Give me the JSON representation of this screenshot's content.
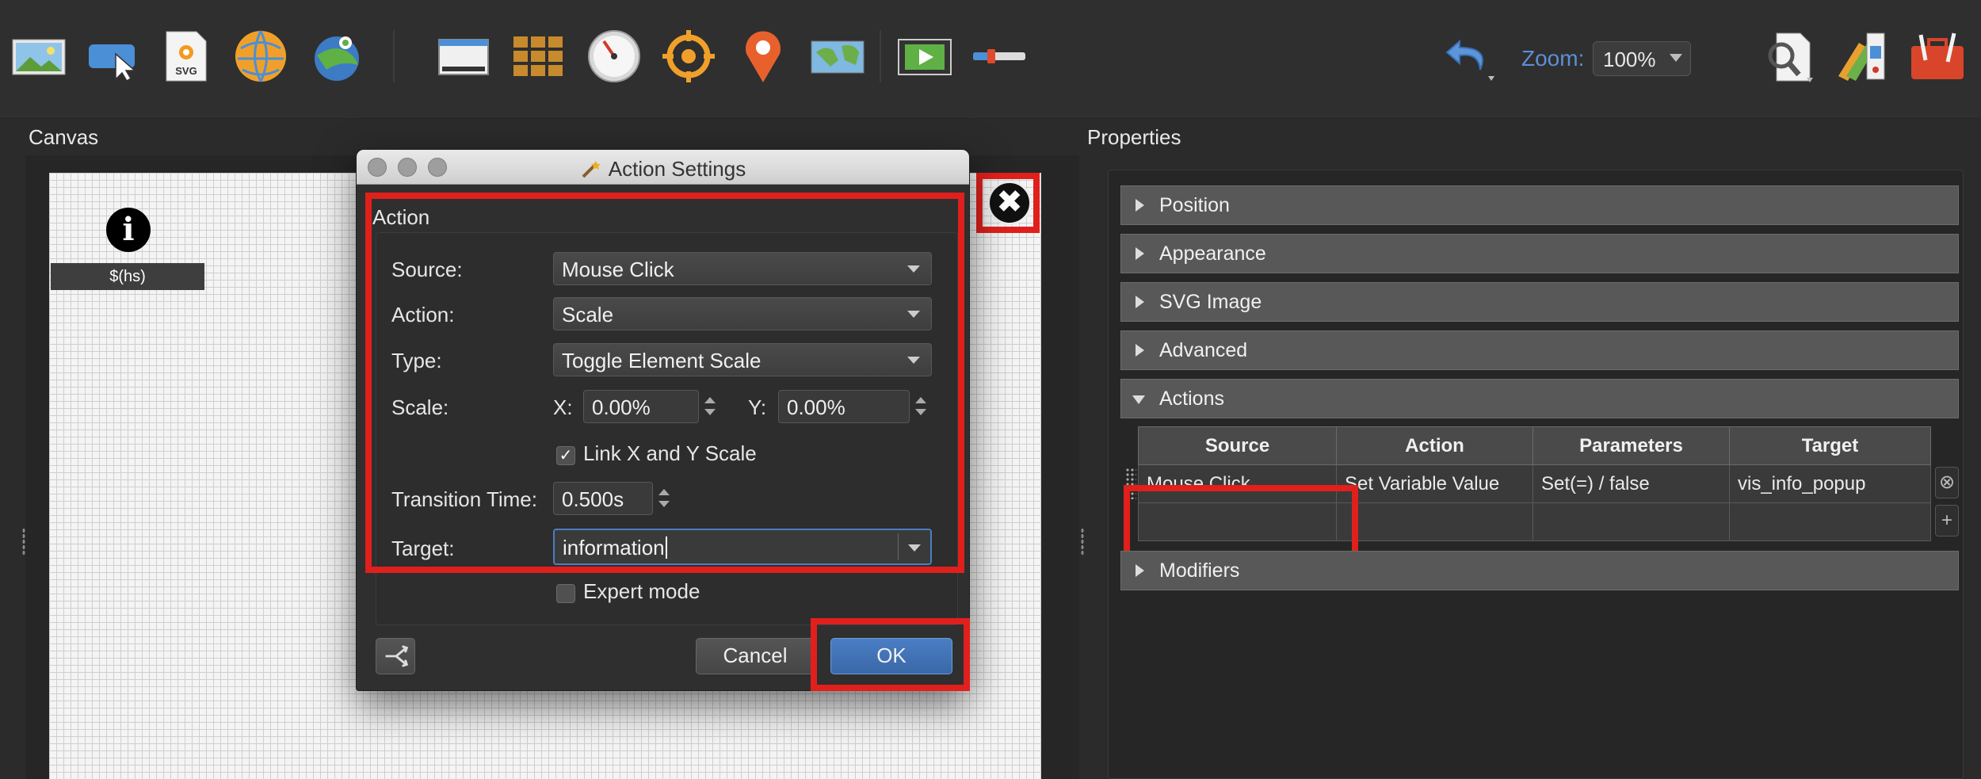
{
  "toolbar": {
    "zoom_label": "Zoom:",
    "zoom_value": "100%",
    "icons": [
      "image-icon",
      "pointer-icon",
      "svg-icon",
      "globe-icon",
      "map-pin-globe-icon",
      "screen-icon",
      "grid-icon",
      "gauge-icon",
      "crosshair-icon",
      "location-pin-icon",
      "map-icon",
      "video-icon",
      "slider-icon",
      "undo-icon",
      "inspect-icon",
      "theme-icon",
      "tools-icon"
    ],
    "svg_text": "SVG"
  },
  "canvas": {
    "title": "Canvas",
    "info_glyph": "i",
    "hotspot_label": "$(hs)",
    "close_glyph": "✖"
  },
  "dialog": {
    "title": "Action Settings",
    "group_title": "Action",
    "source_label": "Source:",
    "source_value": "Mouse Click",
    "action_label": "Action:",
    "action_value": "Scale",
    "type_label": "Type:",
    "type_value": "Toggle Element Scale",
    "scale_label": "Scale:",
    "x_label": "X:",
    "x_value": "0.00%",
    "y_label": "Y:",
    "y_value": "0.00%",
    "link_label": "Link X and Y Scale",
    "link_check": "✓",
    "transition_label": "Transition Time:",
    "transition_value": "0.500s",
    "target_label": "Target:",
    "target_value": "information",
    "expert_label": "Expert mode",
    "cancel_label": "Cancel",
    "ok_label": "OK"
  },
  "properties": {
    "title": "Properties",
    "sections": [
      "Position",
      "Appearance",
      "SVG Image",
      "Advanced",
      "Actions",
      "Modifiers"
    ],
    "table_headers": [
      "Source",
      "Action",
      "Parameters",
      "Target"
    ],
    "table_rows": [
      [
        "Mouse Click",
        "Set Variable Value",
        "Set(=) / false",
        "vis_info_popup"
      ]
    ],
    "remove_glyph": "⊗",
    "add_glyph": "+"
  },
  "colors": {
    "highlight": "#e0201c",
    "accent": "#5d8fd6",
    "ok_button": "#3a68a8"
  }
}
